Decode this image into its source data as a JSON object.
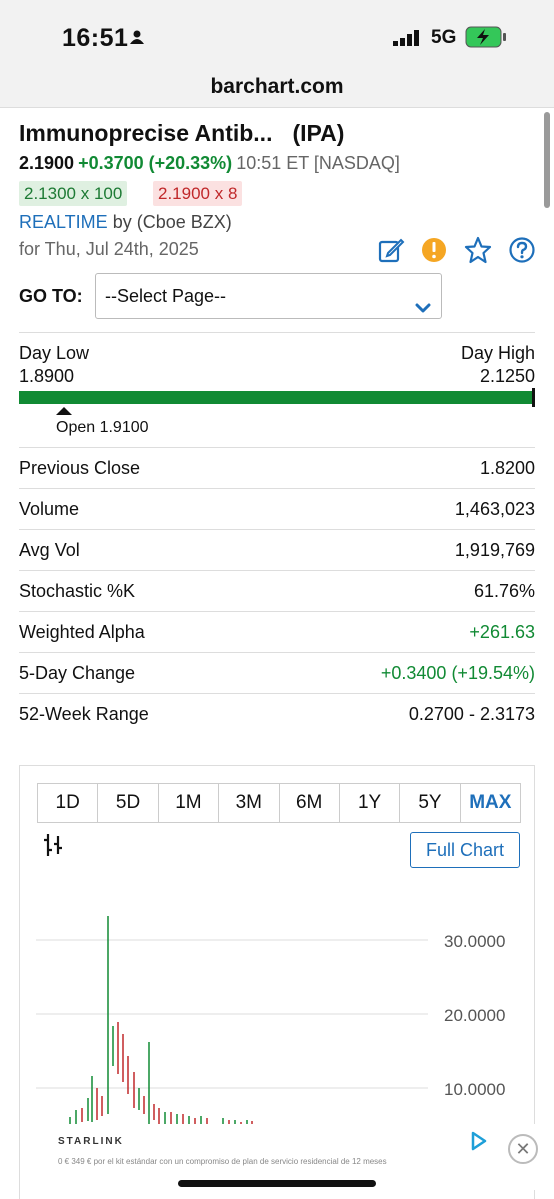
{
  "status_bar": {
    "time": "16:51",
    "network": "5G"
  },
  "browser": {
    "url": "barchart.com"
  },
  "header": {
    "name": "Immunoprecise Antib...",
    "symbol": "(IPA)",
    "last": "2.1900",
    "change": "+0.3700 (+20.33%)",
    "time": "10:51 ET [NASDAQ]",
    "bid": "2.1300 x 100",
    "ask": "2.1900 x 8",
    "realtime_label": "REALTIME",
    "realtime_source": "by (Cboe BZX)",
    "date": "for Thu, Jul 24th, 2025"
  },
  "goto": {
    "label": "GO TO:",
    "selected": "--Select Page--"
  },
  "range": {
    "low_label": "Day Low",
    "low_value": "1.8900",
    "high_label": "Day High",
    "high_value": "2.1250",
    "open_label": "Open 1.9100"
  },
  "stats": [
    {
      "label": "Previous Close",
      "value": "1.8200"
    },
    {
      "label": "Volume",
      "value": "1,463,023"
    },
    {
      "label": "Avg Vol",
      "value": "1,919,769"
    },
    {
      "label": "Stochastic %K",
      "value": "61.76%"
    },
    {
      "label": "Weighted Alpha",
      "value": "+261.63"
    },
    {
      "label": "5-Day Change",
      "value": "+0.3400 (+19.54%)"
    },
    {
      "label": "52-Week Range",
      "value": "0.2700 - 2.3173"
    }
  ],
  "chart": {
    "timeframes": [
      "1D",
      "5D",
      "1M",
      "3M",
      "6M",
      "1Y",
      "5Y",
      "MAX"
    ],
    "active_timeframe": "MAX",
    "full_chart_label": "Full Chart",
    "y_labels": [
      "30.0000",
      "20.0000",
      "10.0000"
    ]
  },
  "ad": {
    "title": "STARLINK",
    "text": "0 € 349 € por el kit estándar con un compromiso de plan de servicio residencial de 12 meses"
  },
  "colors": {
    "green": "#118a34",
    "red": "#c0282a",
    "blue": "#1e6fba"
  }
}
